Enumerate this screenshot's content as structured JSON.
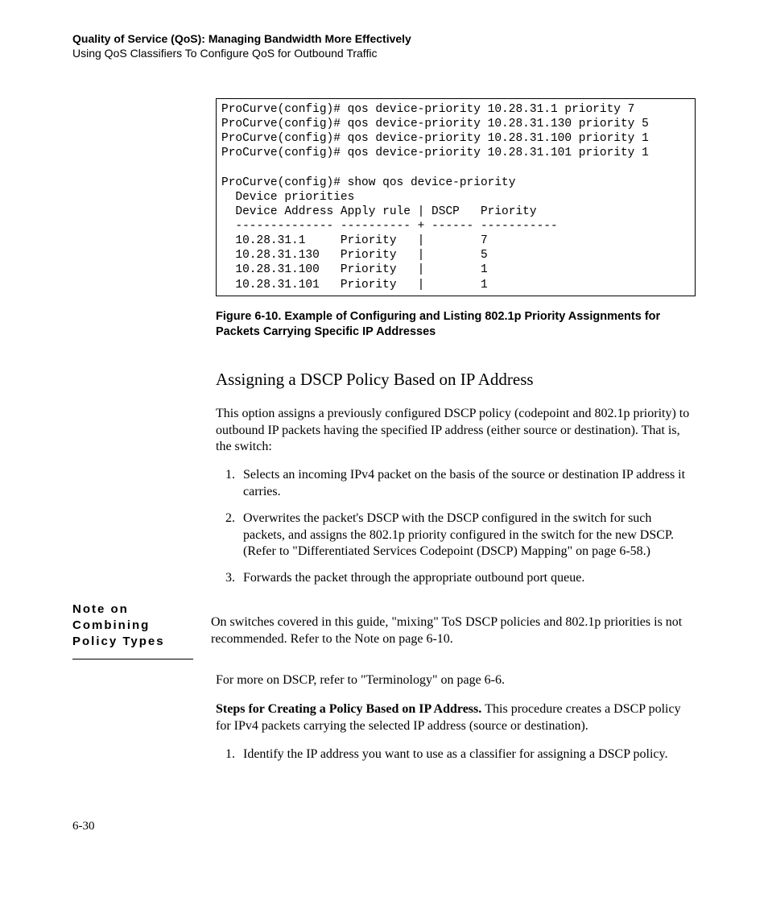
{
  "header": {
    "bold": "Quality of Service (QoS): Managing Bandwidth More Effectively",
    "sub": "Using QoS Classifiers To Configure QoS for Outbound Traffic"
  },
  "terminal": "ProCurve(config)# qos device-priority 10.28.31.1 priority 7\nProCurve(config)# qos device-priority 10.28.31.130 priority 5\nProCurve(config)# qos device-priority 10.28.31.100 priority 1\nProCurve(config)# qos device-priority 10.28.31.101 priority 1\n\nProCurve(config)# show qos device-priority\n  Device priorities\n  Device Address Apply rule | DSCP   Priority\n  -------------- ---------- + ------ -----------\n  10.28.31.1     Priority   |        7\n  10.28.31.130   Priority   |        5\n  10.28.31.100   Priority   |        1\n  10.28.31.101   Priority   |        1",
  "figcap": "Figure 6-10.  Example of Configuring and Listing 802.1p Priority Assignments for Packets Carrying Specific IP Addresses",
  "subhead": "Assigning a DSCP Policy Based on IP Address",
  "intro": "This option assigns a previously configured DSCP policy (codepoint and 802.1p priority) to outbound IP packets having the specified IP address (either source or destination). That is, the switch:",
  "list1": {
    "i1": "Selects an incoming IPv4 packet on the basis of the source or destination IP address it carries.",
    "i2": "Overwrites the packet's DSCP with the DSCP configured in the switch for such packets, and assigns the 802.1p priority configured in the switch for the new DSCP. (Refer to \"Differentiated Services Codepoint (DSCP) Mapping\" on page 6-58.)",
    "i3": "Forwards the packet through the appropriate outbound port queue."
  },
  "note": {
    "label": "Note on Combining Policy Types",
    "body": "On switches covered in this guide, \"mixing\" ToS DSCP policies and 802.1p priorities is not recommended. Refer to the Note on page 6-10."
  },
  "more": "For more on DSCP, refer to \"Terminology\" on page 6-6.",
  "steps": {
    "bold": "Steps for Creating a Policy Based on IP Address.  ",
    "rest": "This procedure creates a DSCP policy for IPv4 packets carrying the selected IP address (source or destination)."
  },
  "list2": {
    "i1": "Identify the IP address you want to use as a classifier for assigning a DSCP policy."
  },
  "pagenum": "6-30"
}
